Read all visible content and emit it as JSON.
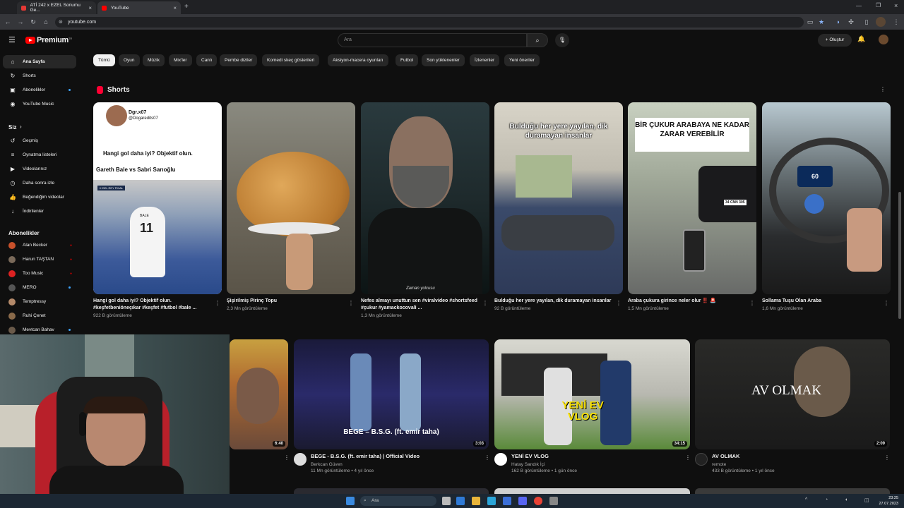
{
  "browser": {
    "tabs": [
      {
        "label": "ATİ 242 x EZEL Sonumu Ge...",
        "active": false
      },
      {
        "label": "YouTube",
        "active": true
      }
    ],
    "url": "youtube.com"
  },
  "masthead": {
    "logo_text": "Premium",
    "logo_badge": "TR",
    "search_placeholder": "Ara",
    "create_label": "Oluştur"
  },
  "sidebar": {
    "main": [
      {
        "label": "Ana Sayfa",
        "icon": "home-icon",
        "glyph": "⌂"
      },
      {
        "label": "Shorts",
        "icon": "shorts-icon",
        "glyph": "↻"
      },
      {
        "label": "Abonelikler",
        "icon": "subscriptions-icon",
        "glyph": "▣"
      },
      {
        "label": "YouTube Music",
        "icon": "music-icon",
        "glyph": "◉"
      }
    ],
    "you_header": "Siz",
    "you": [
      {
        "label": "Geçmiş",
        "icon": "history-icon",
        "glyph": "↺"
      },
      {
        "label": "Oynatma listeleri",
        "icon": "playlist-icon",
        "glyph": "≡"
      },
      {
        "label": "Videolarınız",
        "icon": "your-videos-icon",
        "glyph": "▶"
      },
      {
        "label": "Daha sonra izle",
        "icon": "watch-later-icon",
        "glyph": "◷"
      },
      {
        "label": "Beğendiğim videolar",
        "icon": "like-icon",
        "glyph": "👍"
      },
      {
        "label": "İndirilenler",
        "icon": "download-icon",
        "glyph": "↓"
      }
    ],
    "subs_header": "Abonelikler",
    "subs": [
      {
        "label": "Alan Becker",
        "color": "#c8512b"
      },
      {
        "label": "Harun TAŞTAN",
        "color": "#7a6a5a"
      },
      {
        "label": "Too Music",
        "color": "#d22"
      },
      {
        "label": "MERO",
        "color": "#555"
      },
      {
        "label": "Temptressy",
        "color": "#b48a6a"
      },
      {
        "label": "Ruhi Çenet",
        "color": "#8a6a4a"
      },
      {
        "label": "Mevtcan Bahav",
        "color": "#6a5a4a"
      }
    ]
  },
  "chips": [
    "Tümü",
    "Oyun",
    "Müzik",
    "Mix'ler",
    "Canlı",
    "Pembe diziler",
    "Komedi skeç gösterileri",
    "Aksiyon-macera oyunları",
    "Futbol",
    "Son yüklenenler",
    "İzlenenler",
    "Yeni öneriler"
  ],
  "shorts": {
    "title": "Shorts",
    "items": [
      {
        "title": "Hangi gol daha iyi? Objektif olun. #keşfetbeniöneçıkar #keşfet #futbol #bale ...",
        "views": "922 B görüntüleme",
        "thumb_user": "Dgr.x07",
        "thumb_handle": "@Dogaredits07",
        "thumb_q": "Hangi gol daha iyi? Objektif olun.",
        "thumb_names": "Gareth Bale vs Sabri Sarıoğlu",
        "thumb_bar": "K DEL REY FINAL",
        "thumb_jersey": "11",
        "thumb_jersey_name": "BALE"
      },
      {
        "title": "Şişirilmiş Pirinç Topu",
        "views": "2,3 Mn görüntüleme"
      },
      {
        "title": "Nefes almayı unuttun sen #viralvideo #shortsfeed #çukur #yamackocovali ...",
        "views": "1,3 Mn görüntüleme",
        "thumb_caption": "Zaman yolcusu"
      },
      {
        "title": "Bulduğu her yere yayılan, dik duramayan insanlar",
        "views": "92 B görüntüleme",
        "thumb_text": "Bulduğu her yere yayılan, dik duramayan insanlar"
      },
      {
        "title": "Araba çukura girince neler olur ‼️ 🚨",
        "views": "1,5 Mn görüntüleme",
        "thumb_text": "BİR ÇUKUR ARABAYA NE KADAR ZARAR VEREBİLİR",
        "plate": "34 CNN 305"
      },
      {
        "title": "Sollama Tuşu Olan Araba",
        "views": "1,6 Mn görüntüleme",
        "speed": "60"
      }
    ]
  },
  "videos": [
    {
      "title": "",
      "channel": "",
      "meta": "",
      "duration": "6:40"
    },
    {
      "title": "BEGE - B.S.G. (ft. emir taha) | Official Video",
      "channel": "Berkcan Güven",
      "meta": "11 Mn görüntüleme • 4 yıl önce",
      "duration": "3:03",
      "overlay": "BEGE – B.S.G. (ft. emir taha)"
    },
    {
      "title": "YENİ EV VLOG",
      "channel": "Hatay Sandık İçi",
      "meta": "162 B görüntüleme • 1 gün önce",
      "duration": "34:15",
      "overlay": "YENİ EV VLOG"
    },
    {
      "title": "AV OLMAK",
      "channel": "remote",
      "meta": "433 B görüntüleme • 1 yıl önce",
      "duration": "2:09",
      "overlay": "AV OLMAK"
    }
  ],
  "taskbar": {
    "search_placeholder": "Ara",
    "time": "23:25",
    "date": "27.07.2023"
  },
  "colors": {
    "background": "#0f0f0f",
    "chip": "#272727",
    "brand_red": "#ff0000",
    "text_secondary": "#aaaaaa"
  }
}
